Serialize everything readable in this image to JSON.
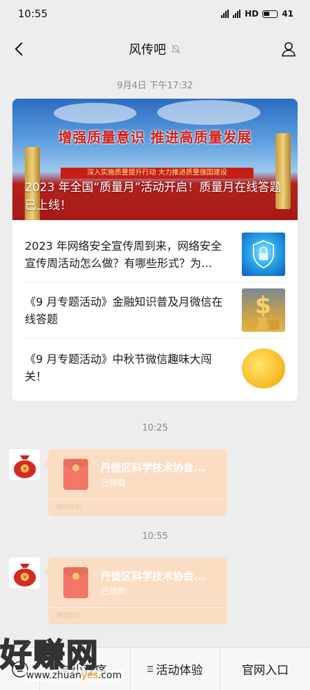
{
  "status_bar": {
    "time": "10:55",
    "network": "HD",
    "battery": "41"
  },
  "nav": {
    "title": "风传吧"
  },
  "timestamps": {
    "article": "9月4日 下午17:32",
    "msg1": "10:25",
    "msg2": "10:55"
  },
  "article": {
    "banner_line1": "增强质量意识 推进高质量发展",
    "banner_line2": "深入实施质量提升行动 大力推进质量强国建设",
    "headline": "2023 年全国“质量月”活动开启！质量月在线答题已上线！",
    "items": [
      {
        "text": "2023 年网络安全宣传周到来，网络安全宣传周活动怎么做？有哪些形式？为…",
        "thumb": "security-shield-icon"
      },
      {
        "text": "《9 月专题活动》金融知识普及月微信在线答题",
        "thumb": "money-icon"
      },
      {
        "text": "《9 月专题活动》中秋节微信趣味大闯关！",
        "thumb": "moon-icon"
      }
    ]
  },
  "messages": [
    {
      "title": "丹徒区科学技术协会...",
      "status": "已领取",
      "footer": "微信红包"
    },
    {
      "title": "丹徒区科学技术协会...",
      "status": "已领取",
      "footer": "微信红包"
    }
  ],
  "bottom_menu": {
    "items": [
      "小程序",
      "活动体验",
      "官网入口"
    ]
  },
  "watermark": {
    "text": "好赚网",
    "url_prefix": "www.zhuan",
    "url_highlight": "yes",
    "url_suffix": ".com"
  },
  "colors": {
    "background": "#ededed",
    "redpacket": "#fbddc4",
    "accent_red": "#d1211c"
  }
}
